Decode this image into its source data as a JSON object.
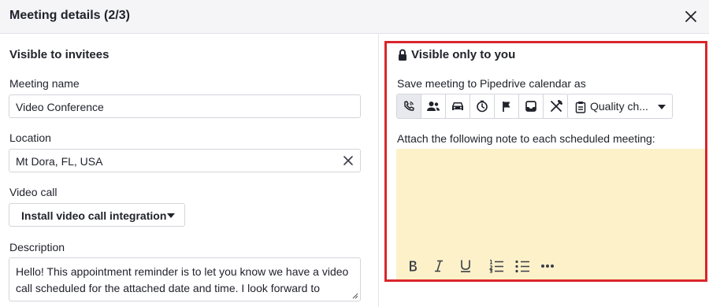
{
  "header": {
    "title": "Meeting details (2/3)",
    "close_icon": "close-icon"
  },
  "invitees": {
    "title": "Visible to invitees",
    "meeting_name": {
      "label": "Meeting name",
      "value": "Video Conference"
    },
    "location": {
      "label": "Location",
      "value": "Mt Dora, FL, USA"
    },
    "video_call": {
      "label": "Video call",
      "value": "Install video call integration"
    },
    "description": {
      "label": "Description",
      "value": "Hello! This appointment reminder is to let you know we have a video call scheduled for the attached date and time. I look forward to speaking with you!"
    }
  },
  "private": {
    "title": "Visible only to you",
    "lock_icon": "lock-icon",
    "calendar_label": "Save meeting to Pipedrive calendar as",
    "activity_types": [
      {
        "name": "call",
        "icon": "phone-icon",
        "active": true
      },
      {
        "name": "meeting",
        "icon": "people-icon",
        "active": false
      },
      {
        "name": "task",
        "icon": "car-icon",
        "active": false
      },
      {
        "name": "deadline",
        "icon": "clock-icon",
        "active": false
      },
      {
        "name": "flag",
        "icon": "flag-icon",
        "active": false
      },
      {
        "name": "email",
        "icon": "inbox-icon",
        "active": false
      },
      {
        "name": "lunch",
        "icon": "utensils-icon",
        "active": false
      }
    ],
    "selected_type": "Quality ch...",
    "note_label": "Attach the following note to each scheduled meeting:",
    "note_value": "",
    "toolbar": [
      "bold-icon",
      "italic-icon",
      "underline-icon",
      "ordered-list-icon",
      "bullet-list-icon",
      "more-icon"
    ]
  },
  "colors": {
    "highlight_border": "#d9262a",
    "note_background": "#fcf1c9",
    "header_background": "#f5f5f7"
  }
}
